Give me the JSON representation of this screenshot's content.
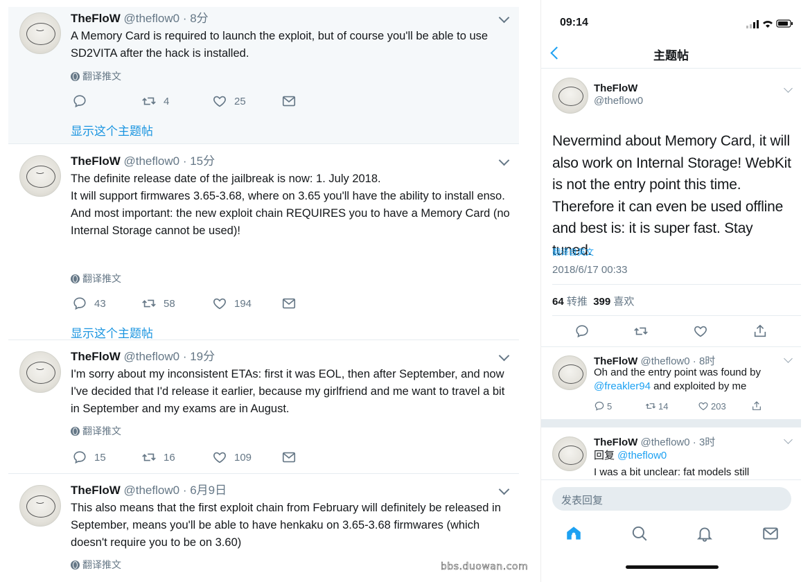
{
  "timeline": {
    "translate_label": "翻译推文",
    "show_thread_label": "显示这个主题帖",
    "tweets": [
      {
        "name": "TheFloW",
        "handle": "@theflow0",
        "time": "· 8分",
        "text": "A Memory Card is required to launch the exploit, but of course you'll be able to use SD2VITA after the hack is installed.",
        "replies": "",
        "retweets": "4",
        "likes": "25"
      },
      {
        "name": "TheFloW",
        "handle": "@theflow0",
        "time": "· 15分",
        "text_lines": [
          "The definite release date of the jailbreak is now: 1. July 2018.",
          "It will support firmwares 3.65-3.68, where on 3.65 you'll have the ability to install enso.",
          "And most important: the new exploit chain REQUIRES you to have a Memory Card (no Internal Storage cannot be used)!"
        ],
        "replies": "43",
        "retweets": "58",
        "likes": "194"
      },
      {
        "name": "TheFloW",
        "handle": "@theflow0",
        "time": "· 19分",
        "text": "I'm sorry about my inconsistent ETAs: first it was EOL, then after September, and now I've decided that I'd release it earlier, because my girlfriend and me want to travel a bit in September and my exams are in August.",
        "replies": "15",
        "retweets": "16",
        "likes": "109"
      },
      {
        "name": "TheFloW",
        "handle": "@theflow0",
        "time": "· 6月9日",
        "text": "This also means that the first exploit chain from February will definitely be released in September, means you'll be able to have henkaku on 3.65-3.68 firmwares (which doesn't require you to be on 3.60)"
      }
    ]
  },
  "phone": {
    "status_time": "09:14",
    "nav_title": "主题帖",
    "main_tweet": {
      "name": "TheFloW",
      "handle": "@theflow0",
      "text": "Nevermind about Memory Card, it will also work on Internal Storage! WebKit is not the entry point this time. Therefore it can even be used offline and best is: it is super fast. Stay tuned.",
      "translate_label": "翻译自英文",
      "date": "2018/6/17 00:33",
      "retweet_count": "64",
      "retweet_label": "转推",
      "like_count": "399",
      "like_label": "喜欢"
    },
    "replies": [
      {
        "name": "TheFloW",
        "handle": "@theflow0",
        "time": "· 8时",
        "text_pre": "Oh and the entry point was found by ",
        "mention": "@freakler94",
        "text_post": " and exploited by me",
        "replies": "5",
        "retweets": "14",
        "likes": "203"
      },
      {
        "name": "TheFloW",
        "handle": "@theflow0",
        "time": "· 3时",
        "reply_prefix": "回复 ",
        "reply_to": "@theflow0",
        "text": "I was a bit unclear: fat models still"
      }
    ],
    "compose_placeholder": "发表回复",
    "tabs": [
      "home-icon",
      "search-icon",
      "bell-icon",
      "mail-icon"
    ]
  },
  "watermark": "bbs.duowan.com",
  "colors": {
    "accent": "#1da1f2",
    "link": "#1b95e0",
    "muted": "#657786",
    "highlight_bg": "#f5f8fa"
  }
}
